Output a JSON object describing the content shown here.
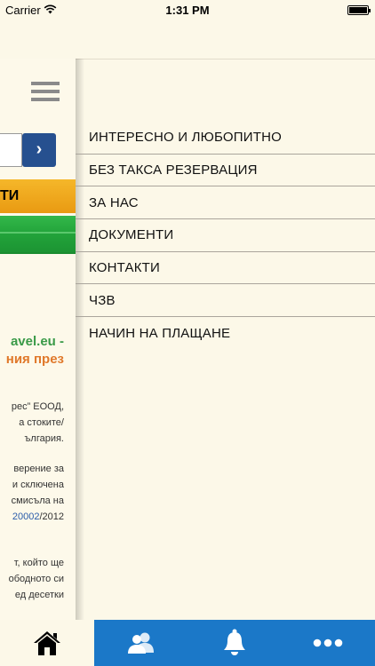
{
  "status_bar": {
    "carrier": "Carrier",
    "time": "1:31 PM"
  },
  "background_page": {
    "orange_button_fragment": "ТИ",
    "fragments": [
      {
        "text": "avel.eu -",
        "style": "green"
      },
      {
        "text": "ния през",
        "style": "orange"
      },
      {
        "text": "рес” ЕООД,",
        "style": "normal"
      },
      {
        "text": "а стоките/",
        "style": "normal"
      },
      {
        "text": "ългария.",
        "style": "normal"
      },
      {
        "text": "верение за",
        "style": "normal"
      },
      {
        "text": "и сключена",
        "style": "normal"
      },
      {
        "text": "смисъла на",
        "style": "normal"
      },
      {
        "text_link": "20002",
        "text_after": "/2012",
        "style": "link"
      },
      {
        "text": "т, който ще",
        "style": "normal"
      },
      {
        "text": "ободното си",
        "style": "normal"
      },
      {
        "text": "ед десетки",
        "style": "normal"
      }
    ]
  },
  "menu": {
    "items": [
      {
        "label": "ИНТЕРЕСНО И ЛЮБОПИТНО"
      },
      {
        "label": "БЕЗ ТАКСА РЕЗЕРВАЦИЯ"
      },
      {
        "label": "ЗА НАС"
      },
      {
        "label": "ДОКУМЕНТИ"
      },
      {
        "label": "КОНТАКТИ"
      },
      {
        "label": "ЧЗВ"
      },
      {
        "label": "НАЧИН НА ПЛАЩАНЕ"
      }
    ]
  },
  "tab_bar": {
    "tabs": [
      {
        "icon": "home-icon",
        "active": true
      },
      {
        "icon": "contacts-icon",
        "active": false
      },
      {
        "icon": "bell-icon",
        "active": false
      },
      {
        "icon": "more-icon",
        "active": false
      }
    ],
    "active_color": "#fcf8e8",
    "bar_color": "#1b78c8"
  }
}
